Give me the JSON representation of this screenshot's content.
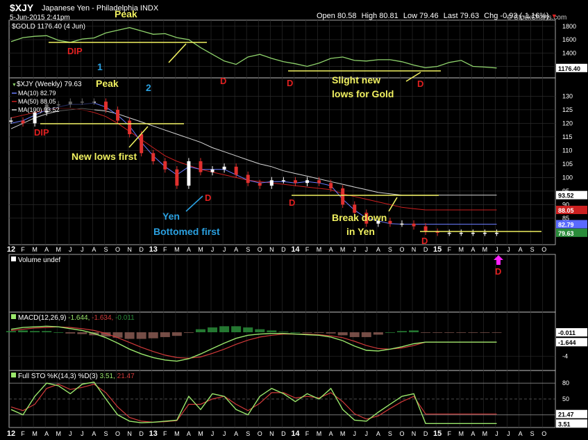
{
  "header": {
    "symbol": "$XJY",
    "name": "Japanese Yen - Philadelphia INDX",
    "date": "5-Jun-2015 2:41pm",
    "watermark": "© StockCharts.com",
    "quote": {
      "open_label": "Open",
      "open": "80.58",
      "high_label": "High",
      "high": "80.81",
      "low_label": "Low",
      "low": "79.46",
      "last_label": "Last",
      "last": "79.63",
      "chg_label": "Chg",
      "chg": "-0.93 (-1.16%)"
    }
  },
  "colors": {
    "gold": "#8fd36c",
    "price_up": "#ffffff",
    "price_down": "#e0302e",
    "ma10": "#6a7cff",
    "ma50": "#cc2020",
    "ma100": "#d8d8d8",
    "annot_yellow": "#f0f060",
    "annot_red": "#e02020",
    "annot_blue": "#2aa0e0",
    "annot_magenta": "#ff22ff",
    "hist_pos": "#2a8c3a",
    "hist_neg": "#8a5a52",
    "macd_line": "#9be86c",
    "signal_line": "#d23a3a",
    "sto_k": "#9be86c",
    "sto_d": "#d23a3a"
  },
  "x_axis": {
    "labels": [
      "12",
      "F",
      "M",
      "A",
      "M",
      "J",
      "J",
      "A",
      "S",
      "O",
      "N",
      "D",
      "13",
      "F",
      "M",
      "A",
      "M",
      "J",
      "J",
      "A",
      "S",
      "O",
      "N",
      "D",
      "14",
      "F",
      "M",
      "A",
      "M",
      "J",
      "J",
      "A",
      "S",
      "O",
      "N",
      "D",
      "15",
      "F",
      "M",
      "A",
      "M",
      "J",
      "J",
      "A",
      "S",
      "O"
    ]
  },
  "chart_data": [
    {
      "type": "line",
      "panel": "gold",
      "legend": "$GOLD 1176.40 (4 Jun)",
      "last_value": "1176.40",
      "ylim": [
        1060,
        1860
      ],
      "y_ticks": [
        "1800",
        "1600",
        "1400",
        "1200"
      ],
      "x": [
        0,
        1,
        2,
        3,
        4,
        5,
        6,
        7,
        8,
        9,
        10,
        11,
        12,
        13,
        14,
        15,
        16,
        17,
        18,
        19,
        20,
        21,
        22,
        23,
        24,
        25,
        26,
        27,
        28,
        29,
        30,
        31,
        32,
        33,
        34,
        35,
        36,
        37,
        38,
        39,
        40,
        41
      ],
      "series": [
        {
          "values": [
            1570,
            1630,
            1650,
            1660,
            1590,
            1560,
            1610,
            1625,
            1700,
            1740,
            1780,
            1730,
            1680,
            1690,
            1630,
            1600,
            1480,
            1380,
            1280,
            1230,
            1340,
            1380,
            1320,
            1270,
            1240,
            1200,
            1250,
            1320,
            1340,
            1290,
            1280,
            1300,
            1300,
            1270,
            1220,
            1180,
            1200,
            1260,
            1290,
            1200,
            1190,
            1176
          ]
        }
      ],
      "annotations": [
        "Peak",
        "DIP",
        "1",
        "D",
        "D",
        "Slight new lows for Gold",
        "D"
      ]
    },
    {
      "type": "line",
      "panel": "price",
      "legend": "$XJY (Weekly) 79.63",
      "ylim": [
        76,
        136
      ],
      "y_ticks": [
        "130",
        "125",
        "120",
        "115",
        "110",
        "105",
        "100",
        "95",
        "90",
        "85"
      ],
      "right_labels": [
        "93.52",
        "88.05",
        "82.79",
        "79.63"
      ],
      "x": [
        0,
        1,
        2,
        3,
        4,
        5,
        6,
        7,
        8,
        9,
        10,
        11,
        12,
        13,
        14,
        15,
        16,
        17,
        18,
        19,
        20,
        21,
        22,
        23,
        24,
        25,
        26,
        27,
        28,
        29,
        30,
        31,
        32,
        33,
        34,
        35,
        36,
        37,
        38,
        39,
        40,
        41
      ],
      "series": [
        {
          "name": "$XJY",
          "values": [
            121,
            120,
            124,
            127,
            127,
            128,
            128,
            128,
            125,
            121,
            116,
            109,
            106,
            103,
            97,
            106,
            102,
            103,
            104,
            101,
            98,
            97,
            99,
            99,
            98,
            99,
            98,
            96,
            90,
            87,
            83,
            84,
            83,
            83,
            82,
            80,
            79.63,
            79.63,
            79.63,
            79.63,
            79.63,
            79.63
          ]
        },
        {
          "name": "MA(10) 82.79",
          "values": [
            120,
            121,
            123,
            125,
            126,
            127,
            127,
            127.5,
            126,
            123,
            119,
            113,
            108,
            104,
            101,
            104,
            103,
            103,
            103,
            101,
            99,
            98,
            98.5,
            98.5,
            98,
            98.5,
            98,
            97,
            92,
            88,
            85,
            84,
            83,
            82.8,
            82.8,
            82.79,
            82.79,
            82.79,
            82.79,
            82.79,
            82.79,
            82.79
          ]
        },
        {
          "name": "MA(50) 88.05",
          "values": [
            122,
            123,
            124,
            125,
            125.5,
            125.5,
            125,
            124,
            122.5,
            120,
            117,
            114,
            111,
            108,
            106,
            104.5,
            103,
            102,
            101,
            100,
            99,
            98.5,
            98,
            97.5,
            97,
            96.5,
            96,
            95.5,
            94,
            93,
            92,
            91,
            90,
            89,
            88.5,
            88.05,
            88.05,
            88.05,
            88.05,
            88.05,
            88.05,
            88.05
          ]
        },
        {
          "name": "MA(100) 93.52",
          "values": [
            118,
            120,
            122,
            123.5,
            124.5,
            125,
            125.5,
            125,
            124.5,
            123.5,
            122,
            120.5,
            119,
            117.5,
            116,
            114.5,
            113,
            111,
            109.5,
            108,
            106.5,
            105,
            104,
            102.5,
            101.5,
            100.5,
            99.5,
            98.5,
            97.5,
            96.5,
            95.5,
            94.5,
            94,
            93.5,
            93.52,
            93.52,
            93.52,
            93.52,
            93.52,
            93.52,
            93.52,
            93.52
          ]
        }
      ],
      "annotations": [
        "Peak",
        "2",
        "DIP",
        "New lows first",
        "D",
        "Yen",
        "Bottomed first",
        "D",
        "Break down",
        "in Yen",
        "D"
      ]
    },
    {
      "type": "bar",
      "panel": "volume",
      "legend": "Volume undef",
      "annotations": [
        "D"
      ]
    },
    {
      "type": "line",
      "panel": "macd",
      "legend_name": "MACD(12,26,9)",
      "legend_values": [
        "-1.644",
        "-1.634",
        "-0.011"
      ],
      "y_ticks": [
        "-4"
      ],
      "right_labels": [
        "-0.011",
        "-1.644"
      ],
      "ylim": [
        -6,
        3
      ],
      "x": [
        0,
        1,
        2,
        3,
        4,
        5,
        6,
        7,
        8,
        9,
        10,
        11,
        12,
        13,
        14,
        15,
        16,
        17,
        18,
        19,
        20,
        21,
        22,
        23,
        24,
        25,
        26,
        27,
        28,
        29,
        30,
        31,
        32,
        33,
        34,
        35,
        36,
        37,
        38,
        39,
        40,
        41
      ],
      "series": [
        {
          "name": "MACD",
          "values": [
            0.5,
            0.8,
            0.9,
            1.0,
            0.9,
            0.6,
            0.3,
            -0.2,
            -0.9,
            -1.8,
            -2.8,
            -3.6,
            -4.2,
            -4.6,
            -4.8,
            -4.4,
            -3.6,
            -2.7,
            -1.8,
            -1.0,
            -0.5,
            -0.3,
            -0.2,
            -0.2,
            -0.3,
            -0.4,
            -0.5,
            -0.8,
            -1.4,
            -2.3,
            -3.0,
            -3.1,
            -2.8,
            -2.4,
            -1.9,
            -1.644,
            -1.644,
            -1.644,
            -1.644,
            -1.644,
            -1.644,
            -1.644
          ]
        },
        {
          "name": "Signal",
          "values": [
            0.3,
            0.5,
            0.7,
            0.8,
            0.9,
            0.8,
            0.6,
            0.3,
            -0.2,
            -0.9,
            -1.7,
            -2.5,
            -3.2,
            -3.8,
            -4.2,
            -4.3,
            -4.1,
            -3.5,
            -2.8,
            -2.0,
            -1.3,
            -0.8,
            -0.5,
            -0.3,
            -0.3,
            -0.3,
            -0.4,
            -0.6,
            -0.9,
            -1.5,
            -2.2,
            -2.7,
            -2.8,
            -2.6,
            -2.2,
            -1.634,
            -1.634,
            -1.634,
            -1.634,
            -1.634,
            -1.634,
            -1.634
          ]
        },
        {
          "name": "Histogram",
          "values": [
            0.2,
            0.3,
            0.2,
            0.2,
            0.0,
            -0.2,
            -0.3,
            -0.5,
            -0.7,
            -0.9,
            -1.1,
            -1.1,
            -1.0,
            -0.8,
            -0.6,
            -0.1,
            0.5,
            0.8,
            1.0,
            1.0,
            0.8,
            0.5,
            0.3,
            0.1,
            0.0,
            -0.1,
            -0.1,
            -0.2,
            -0.5,
            -0.8,
            -0.8,
            -0.4,
            0.0,
            0.2,
            0.3,
            -0.011,
            -0.011,
            -0.011,
            -0.011,
            -0.011,
            -0.011,
            -0.011
          ]
        }
      ]
    },
    {
      "type": "line",
      "panel": "sto",
      "legend_name": "Full STO %K(14,3) %D(3)",
      "legend_values": [
        "3.51",
        "21.47"
      ],
      "y_ticks": [
        "80",
        "50",
        "20"
      ],
      "right_labels": [
        "21.47",
        "3.51"
      ],
      "ylim": [
        0,
        100
      ],
      "x": [
        0,
        1,
        2,
        3,
        4,
        5,
        6,
        7,
        8,
        9,
        10,
        11,
        12,
        13,
        14,
        15,
        16,
        17,
        18,
        19,
        20,
        21,
        22,
        23,
        24,
        25,
        26,
        27,
        28,
        29,
        30,
        31,
        32,
        33,
        34,
        35,
        36,
        37,
        38,
        39,
        40,
        41
      ],
      "series": [
        {
          "name": "%K",
          "values": [
            30,
            20,
            55,
            80,
            75,
            60,
            78,
            82,
            50,
            20,
            8,
            5,
            6,
            8,
            10,
            55,
            30,
            60,
            55,
            30,
            20,
            55,
            70,
            60,
            45,
            60,
            50,
            70,
            30,
            10,
            8,
            25,
            40,
            55,
            60,
            3.51,
            3.51,
            3.51,
            3.51,
            3.51,
            3.51,
            3.51
          ]
        },
        {
          "name": "%D",
          "values": [
            35,
            28,
            40,
            70,
            78,
            68,
            72,
            78,
            62,
            35,
            15,
            8,
            6,
            7,
            9,
            40,
            40,
            50,
            55,
            40,
            28,
            42,
            62,
            62,
            52,
            55,
            52,
            62,
            45,
            22,
            12,
            18,
            32,
            45,
            55,
            21.47,
            21.47,
            21.47,
            21.47,
            21.47,
            21.47,
            21.47
          ]
        }
      ]
    }
  ]
}
